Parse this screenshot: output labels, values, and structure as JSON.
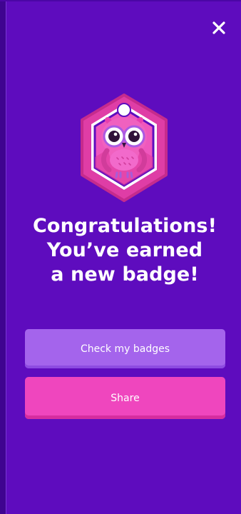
{
  "header": {
    "close_icon": "close-icon"
  },
  "badge": {
    "icon": "owl-badge-icon",
    "colors": {
      "frame": "#df3da6",
      "inner": "#ef57bd",
      "owl": "#f061bf",
      "background": "#5e0cbe"
    }
  },
  "message": {
    "line1": "Congratulations!",
    "line2": "You’ve earned",
    "line3": "a new badge!"
  },
  "actions": {
    "check_badges_label": "Check my badges",
    "share_label": "Share"
  },
  "colors": {
    "background": "#5e0cbe",
    "secondary_button": "#a464ec",
    "primary_button": "#ef46be"
  }
}
